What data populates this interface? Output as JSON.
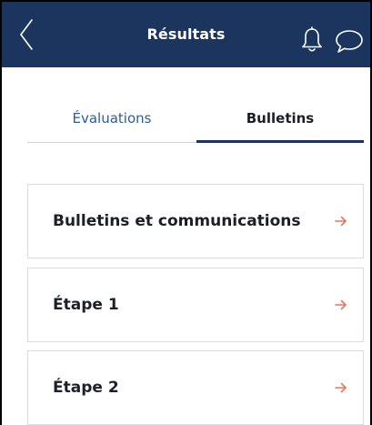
{
  "header": {
    "title": "Résultats",
    "back_icon": "chevron-left-icon",
    "bell_icon": "bell-icon",
    "chat_icon": "chat-bubble-icon",
    "background": "#1b355f"
  },
  "tabs": [
    {
      "label": "Évaluations",
      "active": false
    },
    {
      "label": "Bulletins",
      "active": true
    }
  ],
  "items": [
    {
      "label": "Bulletins et communications",
      "icon": "arrow-right-icon"
    },
    {
      "label": "Étape 1",
      "icon": "arrow-right-icon"
    },
    {
      "label": "Étape 2",
      "icon": "arrow-right-icon"
    }
  ],
  "colors": {
    "accent": "#1b355f",
    "arrow": "#e0795f",
    "inactive_tab": "#2b5d9a"
  }
}
